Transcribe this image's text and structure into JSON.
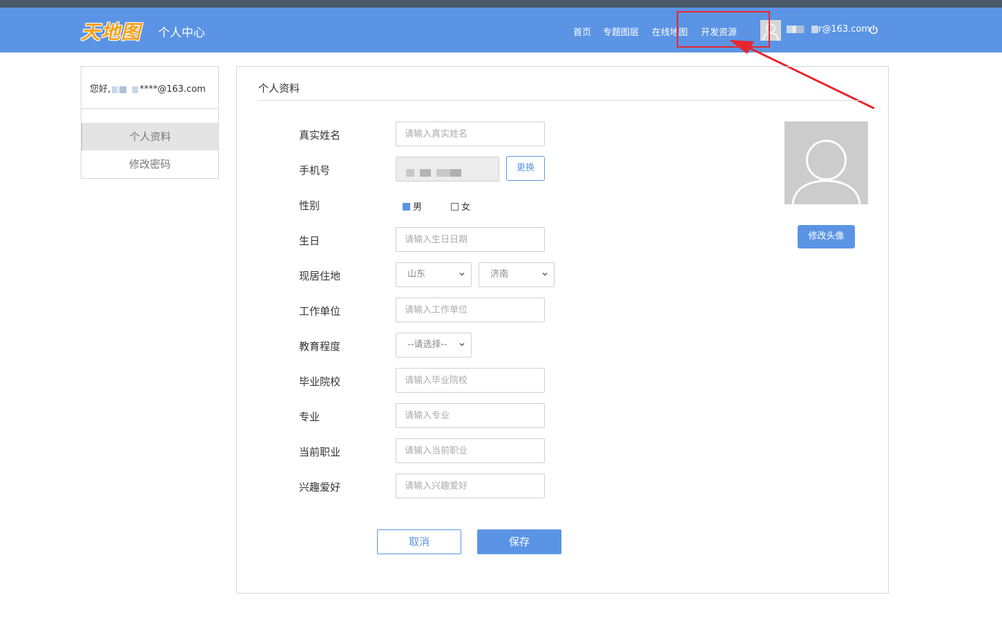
{
  "header": {
    "logo_text": "天地图",
    "title": "个人中心",
    "nav": [
      {
        "label": "首页"
      },
      {
        "label": "专题图层"
      },
      {
        "label": "在线地图"
      },
      {
        "label": "开发资源"
      }
    ],
    "user_email_suffix": "r@163.com"
  },
  "annotation": {
    "color": "#e8262d"
  },
  "sidebar": {
    "greeting_prefix": "您好,",
    "greeting_suffix": "****@163.com",
    "items": [
      {
        "label": "个人资料",
        "active": true
      },
      {
        "label": "修改密码",
        "active": false
      }
    ]
  },
  "panel": {
    "title": "个人资料",
    "fields": {
      "real_name": {
        "label": "真实姓名",
        "placeholder": "请输入真实姓名"
      },
      "phone": {
        "label": "手机号",
        "change_label": "更换"
      },
      "gender": {
        "label": "性别",
        "male": "男",
        "female": "女",
        "selected": "男"
      },
      "birthday": {
        "label": "生日",
        "placeholder": "请输入生日日期"
      },
      "residence": {
        "label": "现居住地",
        "province": "山东",
        "city": "济南"
      },
      "work_unit": {
        "label": "工作单位",
        "placeholder": "请输入工作单位"
      },
      "education": {
        "label": "教育程度",
        "value": "--请选择--"
      },
      "school": {
        "label": "毕业院校",
        "placeholder": "请输入毕业院校"
      },
      "major": {
        "label": "专业",
        "placeholder": "请输入专业"
      },
      "occupation": {
        "label": "当前职业",
        "placeholder": "请输入当前职业"
      },
      "hobbies": {
        "label": "兴趣爱好",
        "placeholder": "请输入兴趣爱好"
      }
    },
    "avatar_button": "修改头像",
    "cancel_label": "取消",
    "save_label": "保存"
  },
  "colors": {
    "brand_blue": "#5b94e5",
    "logo_orange": "#f7a21b"
  }
}
